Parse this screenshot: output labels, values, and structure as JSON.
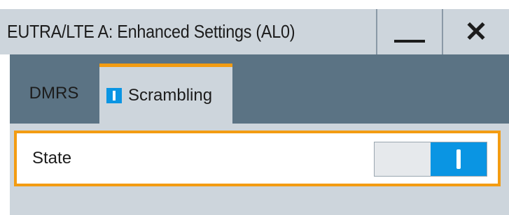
{
  "window": {
    "title": "EUTRA/LTE A: Enhanced Settings (AL0)",
    "minimize_icon": "minimize-icon",
    "close_icon": "close-icon",
    "close_glyph": "✕"
  },
  "tabs": [
    {
      "label": "DMRS",
      "active": false,
      "indicator": false
    },
    {
      "label": "Scrambling",
      "active": true,
      "indicator": true
    }
  ],
  "settings": {
    "state": {
      "label": "State",
      "value": "On"
    }
  },
  "colors": {
    "titlebar": "#cdd5dc",
    "panel_bg": "#5b7384",
    "accent_focus": "#f39c12",
    "toggle_on": "#0a95e3"
  }
}
